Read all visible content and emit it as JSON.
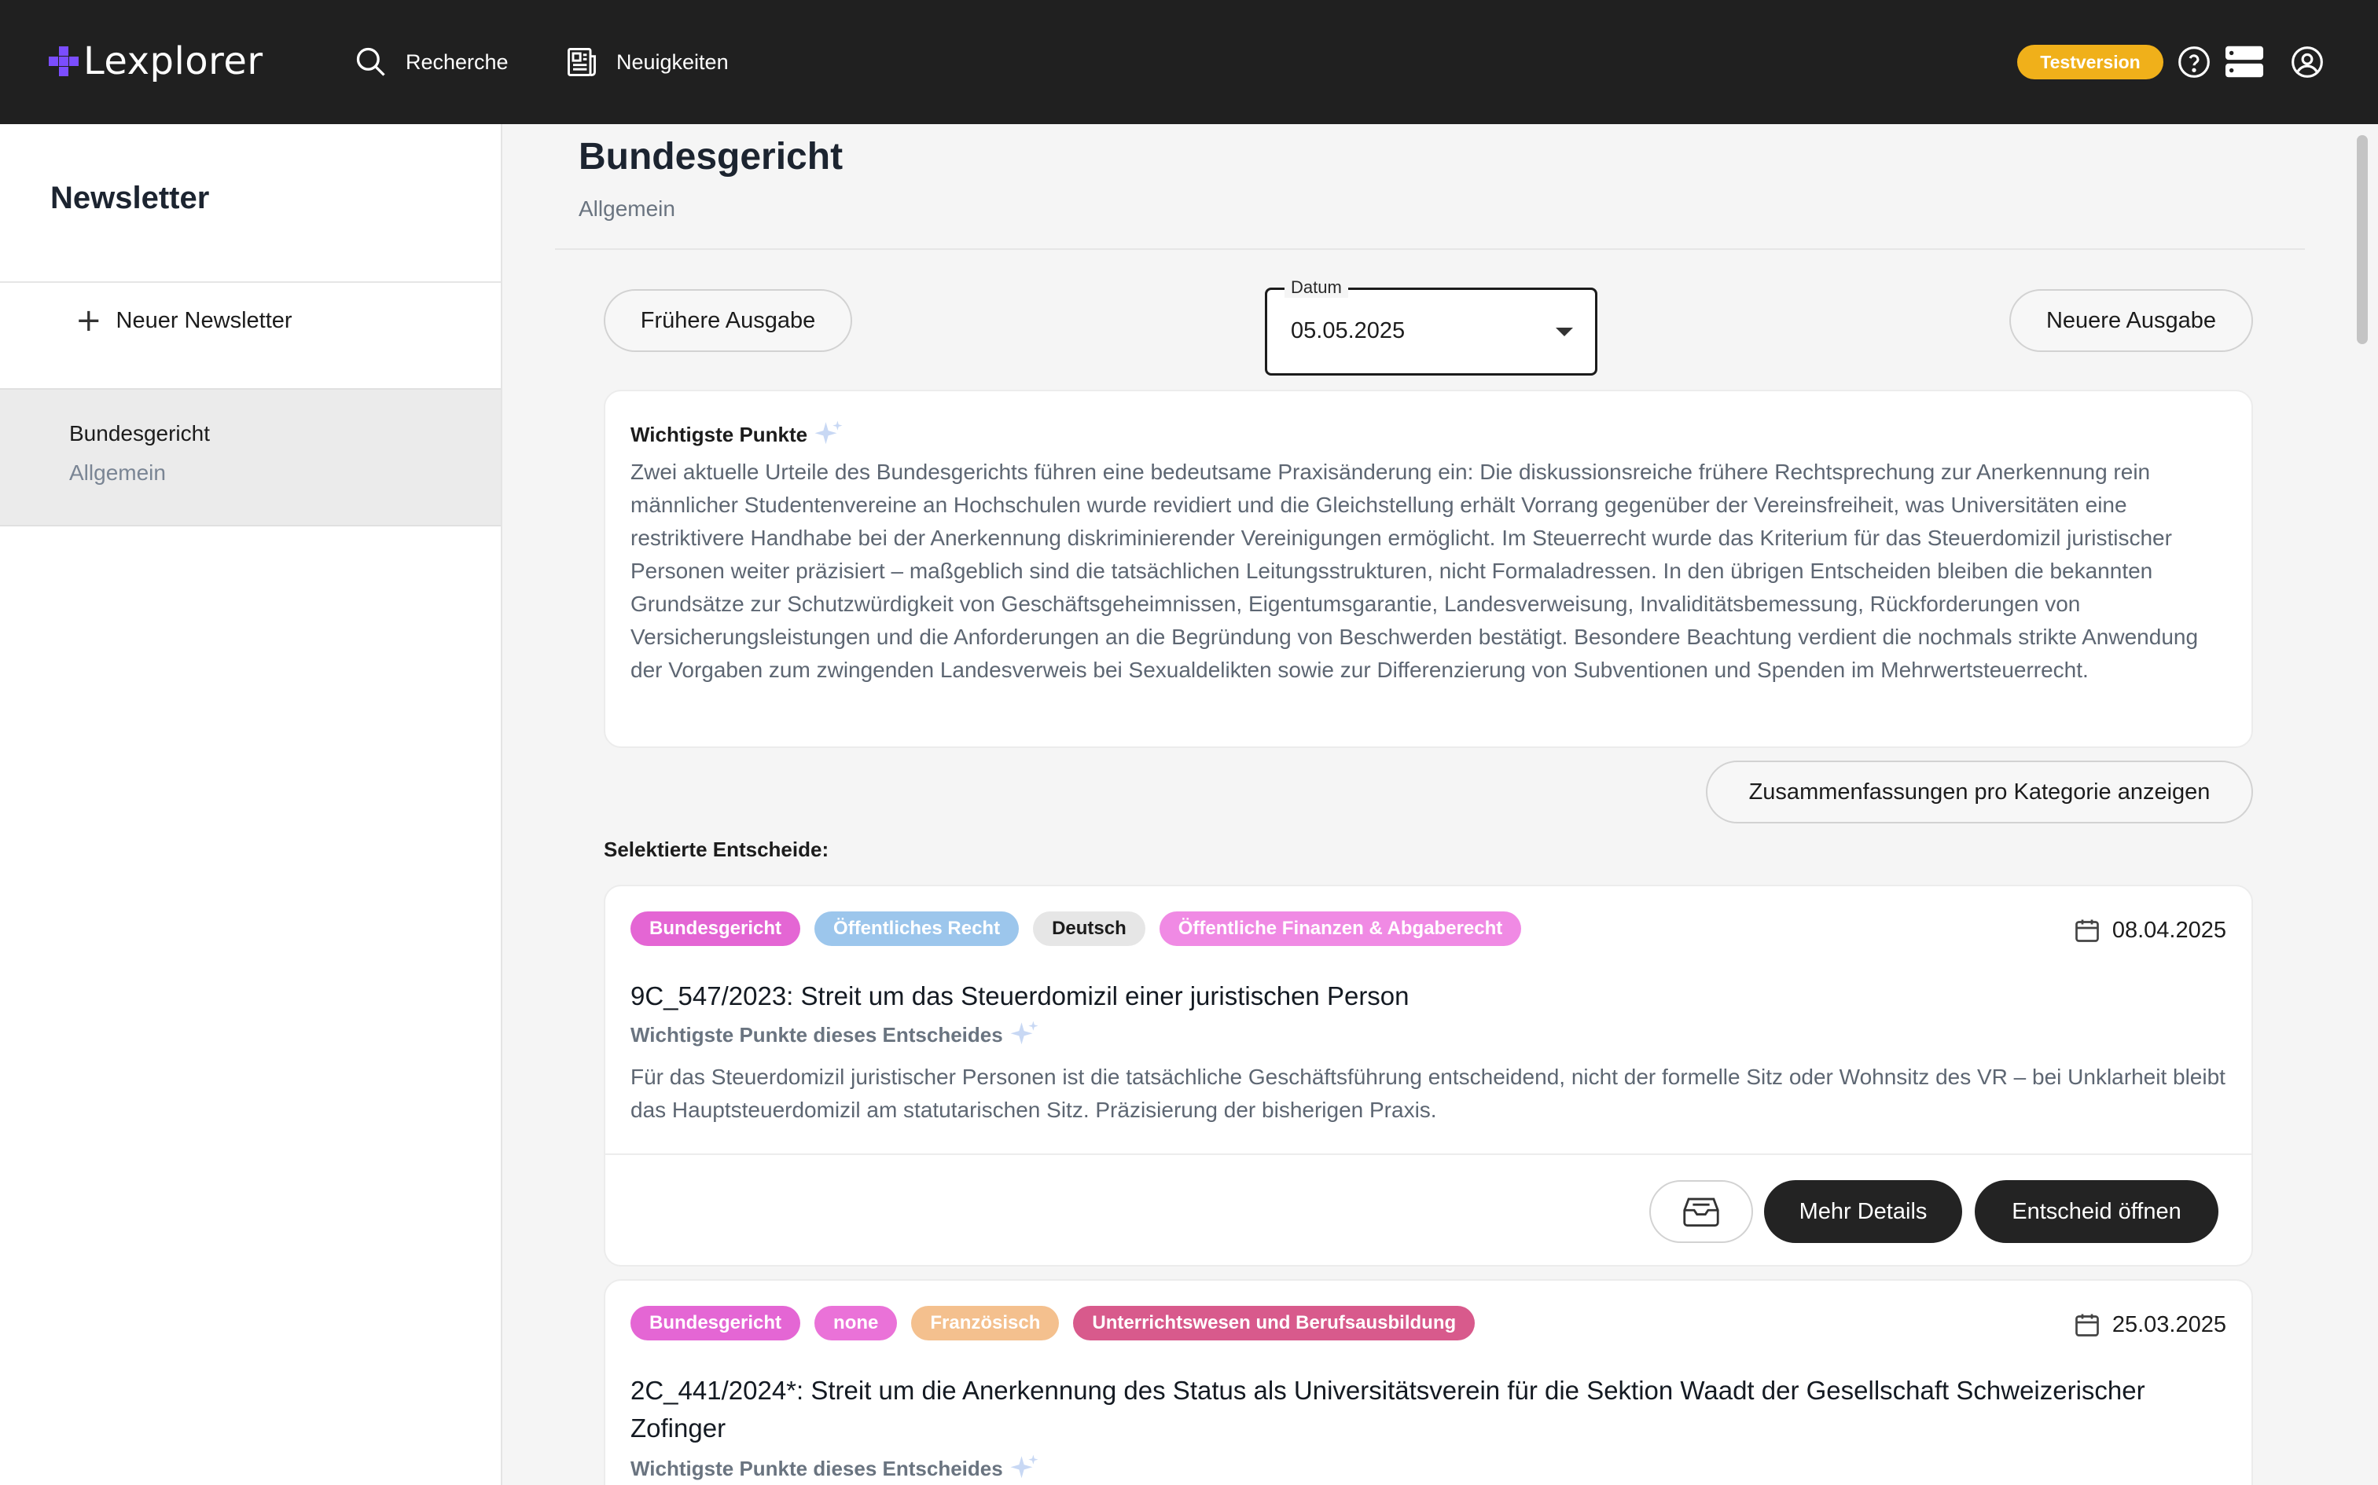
{
  "app": {
    "logo_text": "Lexplorer"
  },
  "nav": {
    "search_label": "Recherche",
    "news_label": "Neuigkeiten",
    "trial_badge": "Testversion"
  },
  "sidebar": {
    "title": "Newsletter",
    "new_label": "Neuer Newsletter",
    "items": [
      {
        "title": "Bundesgericht",
        "subtitle": "Allgemein"
      }
    ]
  },
  "header": {
    "title": "Bundesgericht",
    "subtitle": "Allgemein"
  },
  "controls": {
    "prev_label": "Frühere Ausgabe",
    "next_label": "Neuere Ausgabe",
    "date_label": "Datum",
    "date_value": "05.05.2025"
  },
  "key_points": {
    "title": "Wichtigste Punkte",
    "text": "Zwei aktuelle Urteile des Bundesgerichts führen eine bedeutsame Praxisänderung ein: Die diskussionsreiche frühere Rechtsprechung zur Anerkennung rein männlicher Studentenvereine an Hochschulen wurde revidiert und die Gleichstellung erhält Vorrang gegenüber der Vereinsfreiheit, was Universitäten eine restriktivere Handhabe bei der Anerkennung diskriminierender Vereinigungen ermöglicht. Im Steuerrecht wurde das Kriterium für das Steuerdomizil juristischer Personen weiter präzisiert – maßgeblich sind die tatsächlichen Leitungsstrukturen, nicht Formaladressen. In den übrigen Entscheiden bleiben die bekannten Grundsätze zur Schutzwürdigkeit von Geschäftsgeheimnissen, Eigentumsgarantie, Landesverweisung, Invaliditätsbemessung, Rückforderungen von Versicherungsleistungen und die Anforderungen an die Begründung von Beschwerden bestätigt. Besondere Beachtung verdient die nochmals strikte Anwendung der Vorgaben zum zwingenden Landesverweis bei Sexualdelikten sowie zur Differenzierung von Subventionen und Spenden im Mehrwertsteuerrecht."
  },
  "summary_button": "Zusammenfassungen pro Kategorie anzeigen",
  "selected_label": "Selektierte Entscheide:",
  "decisions": [
    {
      "tags": [
        "Bundesgericht",
        "Öffentliches Recht",
        "Deutsch",
        "Öffentliche Finanzen & Abgaberecht"
      ],
      "date": "08.04.2025",
      "title": "9C_547/2023: Streit um das Steuerdomizil einer juristischen Person",
      "kp_label": "Wichtigste Punkte dieses Entscheides",
      "text": "Für das Steuerdomizil juristischer Personen ist die tatsächliche Geschäftsführung entscheidend, nicht der formelle Sitz oder Wohnsitz des VR – bei Unklarheit bleibt das Hauptsteuerdomizil am statutarischen Sitz. Präzisierung der bisherigen Praxis.",
      "details_label": "Mehr Details",
      "open_label": "Entscheid öffnen"
    },
    {
      "tags": [
        "Bundesgericht",
        "none",
        "Französisch",
        "Unterrichtswesen und Berufsausbildung"
      ],
      "date": "25.03.2025",
      "title": "2C_441/2024*: Streit um die Anerkennung des Status als Universitätsverein für die Sektion Waadt der Gesellschaft Schweizerischer Zofinger",
      "kp_label": "Wichtigste Punkte dieses Entscheides"
    }
  ],
  "colors": {
    "topbar": "#202020",
    "accent": "#7b4dff",
    "trial": "#f0b01a",
    "tag_court": "#e466d4",
    "tag_public_law": "#9cc6ec",
    "tag_language": "#e6e6e6",
    "tag_finance": "#f08ae4",
    "tag_none": "#ea72d8",
    "tag_french": "#f4c08e",
    "tag_education": "#d85a8c"
  }
}
